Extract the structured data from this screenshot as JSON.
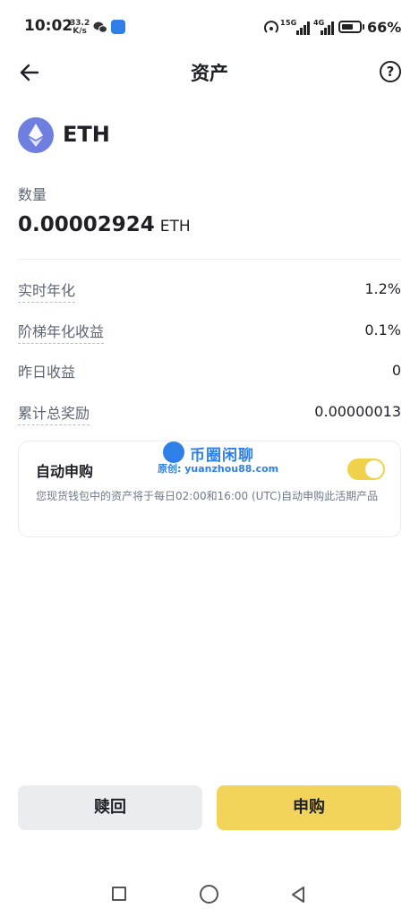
{
  "status_bar": {
    "time": "10:02",
    "speed_value": "33.2",
    "speed_unit": "K/s",
    "network_1": "5G",
    "network_2": "4G",
    "battery_pct": "66%",
    "battery_level": 0.66
  },
  "header": {
    "title": "资产",
    "help_symbol": "?"
  },
  "asset": {
    "name": "ETH",
    "quantity_label": "数量",
    "quantity_value": "0.00002924",
    "quantity_unit": "ETH"
  },
  "stats": [
    {
      "label": "实时年化",
      "value": "1.2%"
    },
    {
      "label": "阶梯年化收益",
      "value": "0.1%"
    },
    {
      "label": "昨日收益",
      "value": "0"
    },
    {
      "label": "累计总奖励",
      "value": "0.00000013"
    }
  ],
  "auto_subscribe": {
    "title": "自动申购",
    "description": "您现货钱包中的资产将于每日02:00和16:00 (UTC)自动申购此活期产品",
    "enabled": true
  },
  "watermark": {
    "title": "币圈闲聊",
    "subtitle": "原创: yuanzhou88.com"
  },
  "actions": {
    "redeem_label": "赎回",
    "subscribe_label": "申购"
  },
  "colors": {
    "accent": "#f3d45a",
    "toggle_on": "#f0d14a",
    "eth": "#6f7fdf",
    "text_primary": "#1e2026",
    "text_secondary": "#5e6673"
  }
}
